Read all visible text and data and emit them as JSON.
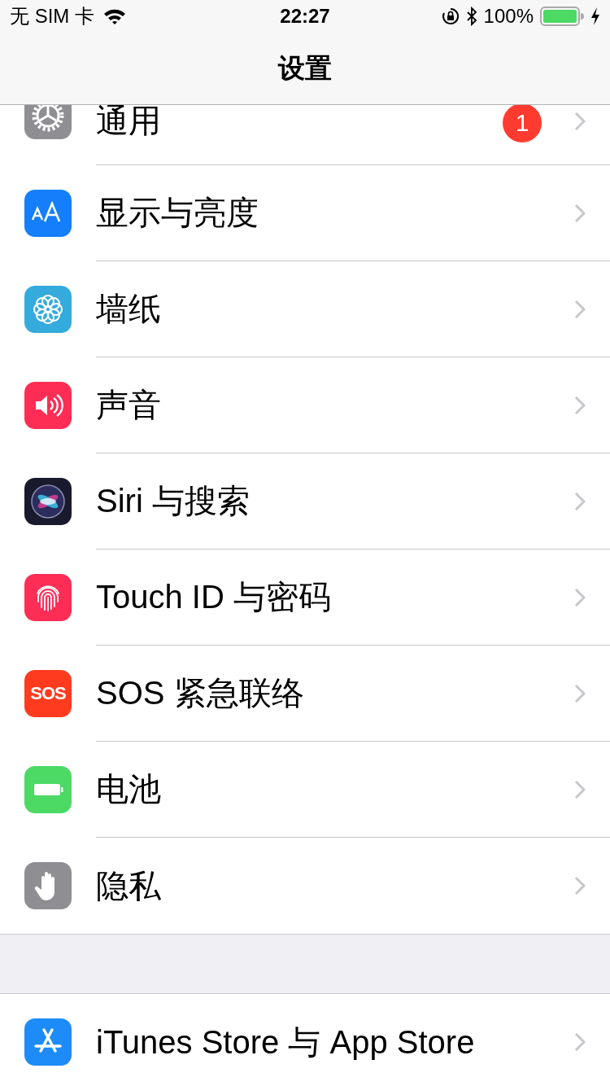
{
  "status_bar": {
    "carrier": "无 SIM 卡",
    "time": "22:27",
    "battery": "100%",
    "charging": true
  },
  "nav": {
    "title": "设置"
  },
  "groups": [
    {
      "items": [
        {
          "kind": "gear",
          "color": "#8e8e93",
          "label": "通用",
          "badge": "1"
        },
        {
          "kind": "text-size",
          "color": "#147efb",
          "label": "显示与亮度"
        },
        {
          "kind": "flower",
          "color": "#35aadc",
          "label": "墙纸"
        },
        {
          "kind": "speaker",
          "color": "#fe2d55",
          "label": "声音"
        },
        {
          "kind": "siri",
          "color": "#1a1a2e",
          "label": "Siri 与搜索"
        },
        {
          "kind": "fingerprint",
          "color": "#fe2d55",
          "label": "Touch ID 与密码"
        },
        {
          "kind": "sos",
          "color": "#fe3b1f",
          "label": "SOS 紧急联络",
          "icon_text": "SOS"
        },
        {
          "kind": "battery",
          "color": "#4cd964",
          "label": "电池"
        },
        {
          "kind": "hand",
          "color": "#8e8e93",
          "label": "隐私"
        }
      ]
    },
    {
      "items": [
        {
          "kind": "appstore",
          "color": "#1d8cf8",
          "label": "iTunes Store 与 App Store"
        }
      ]
    }
  ]
}
